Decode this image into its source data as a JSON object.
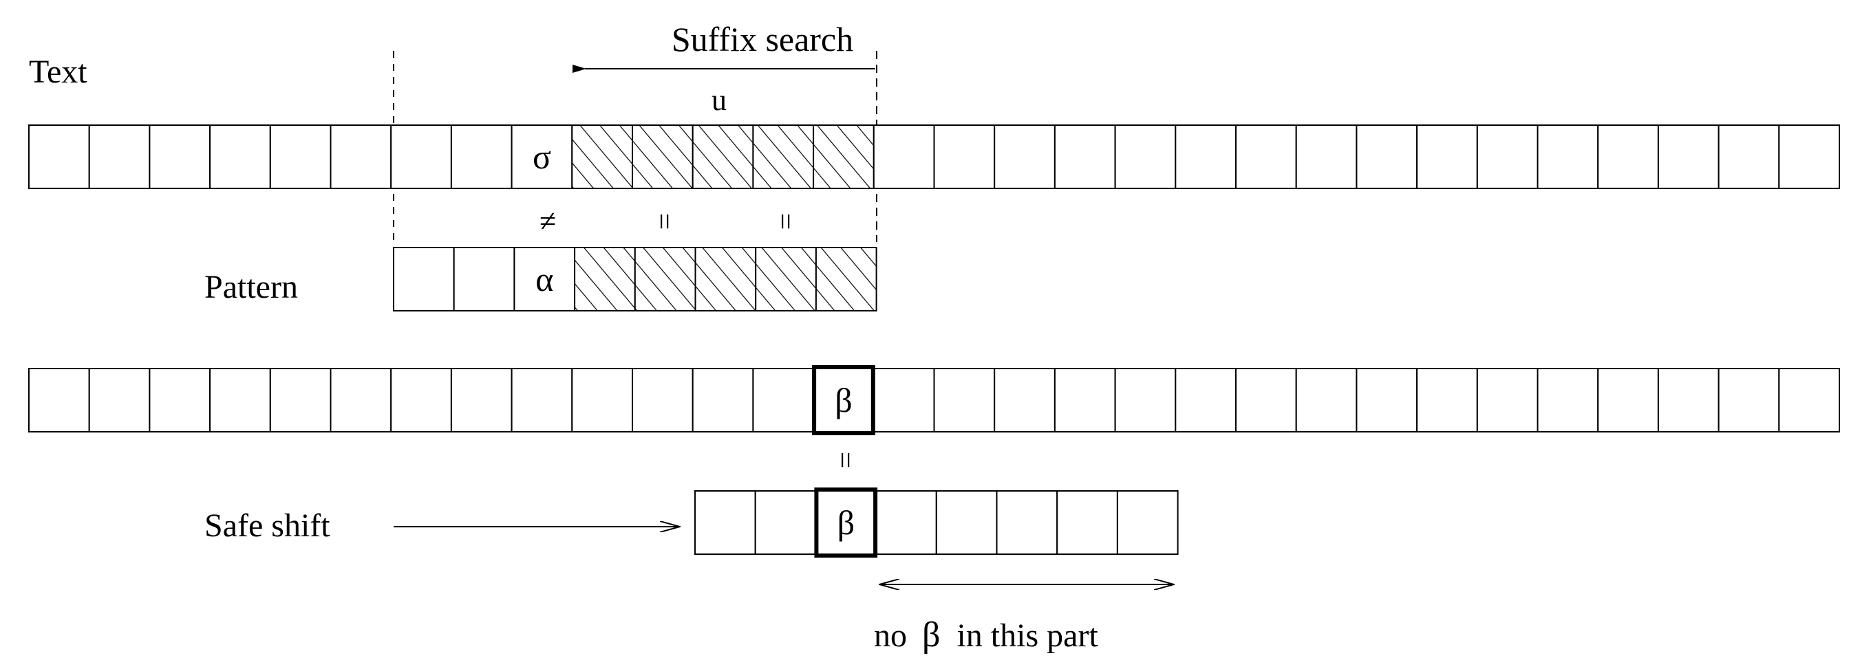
{
  "labels": {
    "text": "Text",
    "suffix_search": "Suffix search",
    "u": "u",
    "pattern": "Pattern",
    "safe_shift": "Safe shift",
    "no_beta_part1": "no",
    "no_beta_symbol": "β",
    "no_beta_part2": "in this part"
  },
  "symbols": {
    "sigma": "σ",
    "alpha": "α",
    "beta_text": "β",
    "beta_pattern": "β",
    "not_equal": "≠",
    "equal_1": "=",
    "equal_2": "=",
    "equal_3": "="
  },
  "rows": {
    "text_row_1": {
      "cell_count": 30,
      "hatched_cells": [
        9,
        10,
        11,
        12,
        13
      ],
      "symbol_cells": {
        "8": "sigma"
      }
    },
    "pattern_row_1": {
      "cell_count": 8,
      "hatched_cells": [
        3,
        4,
        5,
        6,
        7
      ],
      "symbol_cells": {
        "2": "alpha"
      }
    },
    "text_row_2": {
      "cell_count": 30,
      "highlighted_cell": 13,
      "symbol_cells": {
        "13": "beta_text"
      }
    },
    "pattern_row_2": {
      "cell_count": 8,
      "highlighted_cell": 2,
      "symbol_cells": {
        "2": "beta_pattern"
      }
    }
  },
  "colors": {
    "line": "#000000",
    "background": "#ffffff"
  }
}
